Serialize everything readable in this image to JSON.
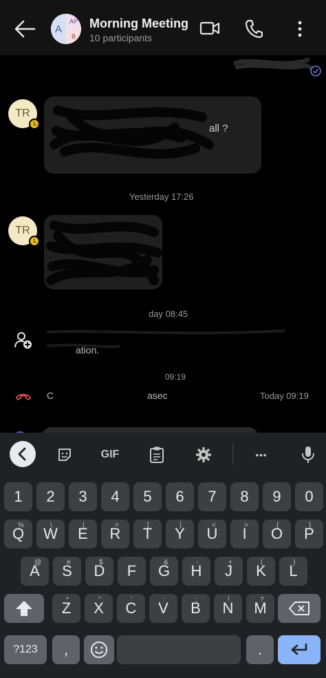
{
  "header": {
    "title": "Morning Meeting",
    "subtitle": "10 participants",
    "avatar": {
      "main_initial": "A",
      "top_right_initials": "AP",
      "bottom_right_initial": "B"
    },
    "icons": [
      "arrow-left-icon",
      "video-icon",
      "phone-icon",
      "more-vert-icon"
    ]
  },
  "chat": {
    "message1": {
      "avatar": "TR",
      "fragment": "all ?"
    },
    "separator1": "Yesterday 17:26",
    "message2": {
      "avatar": "TR"
    },
    "separator2": "day 08:45",
    "system_event_fragment": "ation.",
    "separator3": "09:19",
    "call_event": {
      "fragment": "C",
      "fragment2": "asec",
      "time": "Today 09:19"
    }
  },
  "keyboard": {
    "toolbar": {
      "gif_label": "GIF",
      "more_label": "•••"
    },
    "row_numbers": [
      "1",
      "2",
      "3",
      "4",
      "5",
      "6",
      "7",
      "8",
      "9",
      "0"
    ],
    "row_top": [
      {
        "key": "Q",
        "hint": "%"
      },
      {
        "key": "W",
        "hint": "\\"
      },
      {
        "key": "E",
        "hint": "|"
      },
      {
        "key": "R",
        "hint": "="
      },
      {
        "key": "T",
        "hint": "["
      },
      {
        "key": "Y",
        "hint": "]"
      },
      {
        "key": "U",
        "hint": "<"
      },
      {
        "key": "I",
        "hint": ">"
      },
      {
        "key": "O",
        "hint": "{"
      },
      {
        "key": "P",
        "hint": "}"
      }
    ],
    "row_mid": [
      {
        "key": "A",
        "hint": "@"
      },
      {
        "key": "S",
        "hint": "#"
      },
      {
        "key": "D",
        "hint": "$"
      },
      {
        "key": "F",
        "hint": "_"
      },
      {
        "key": "G",
        "hint": "&"
      },
      {
        "key": "H",
        "hint": "-"
      },
      {
        "key": "J",
        "hint": "+"
      },
      {
        "key": "K",
        "hint": "("
      },
      {
        "key": "L",
        "hint": ")"
      }
    ],
    "row_bottom": [
      {
        "key": "Z",
        "hint": "*"
      },
      {
        "key": "X",
        "hint": "\""
      },
      {
        "key": "C",
        "hint": "'"
      },
      {
        "key": "V",
        "hint": ":"
      },
      {
        "key": "B",
        "hint": ";"
      },
      {
        "key": "N",
        "hint": "!"
      },
      {
        "key": "M",
        "hint": "?"
      }
    ],
    "symbols_label": "?123",
    "comma_label": ",",
    "period_label": "."
  }
}
